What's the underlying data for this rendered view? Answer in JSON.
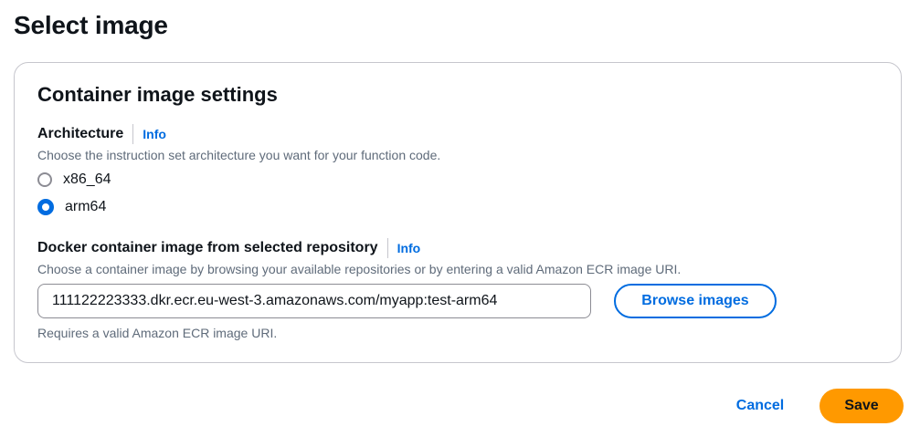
{
  "page": {
    "title": "Select image"
  },
  "panel": {
    "title": "Container image settings"
  },
  "architecture": {
    "label": "Architecture",
    "info_label": "Info",
    "description": "Choose the instruction set architecture you want for your function code.",
    "options": [
      {
        "label": "x86_64",
        "checked": false
      },
      {
        "label": "arm64",
        "checked": true
      }
    ]
  },
  "image_uri": {
    "label": "Docker container image from selected repository",
    "info_label": "Info",
    "description": "Choose a container image by browsing your available repositories or by entering a valid Amazon ECR image URI.",
    "value": "111122223333.dkr.ecr.eu-west-3.amazonaws.com/myapp:test-arm64",
    "browse_label": "Browse images",
    "constraint": "Requires a valid Amazon ECR image URI."
  },
  "footer": {
    "cancel_label": "Cancel",
    "save_label": "Save"
  },
  "colors": {
    "accent": "#006ce0",
    "primary_button": "#ff9900",
    "border": "#c6c6cd",
    "secondary_text": "#5f6b7a"
  }
}
